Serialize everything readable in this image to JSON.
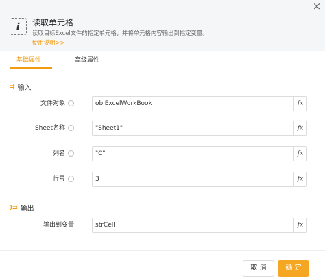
{
  "header": {
    "icon_glyph": "i",
    "title": "读取单元格",
    "description": "读取目标Excel文件的指定单元格，并将单元格内容输出到指定变量。",
    "help_link": "使用说明>>",
    "close_glyph": "×"
  },
  "tabs": [
    {
      "label": "基础属性",
      "active": true
    },
    {
      "label": "高级属性",
      "active": false
    }
  ],
  "input_section": {
    "icon": "⇉",
    "title": "输入",
    "fields": [
      {
        "label": "文件对象",
        "value": "objExcelWorkBook",
        "fx": "fx"
      },
      {
        "label": "Sheet名称",
        "value": "\"Sheet1\"",
        "fx": "fx"
      },
      {
        "label": "列名",
        "value": "\"C\"",
        "fx": "fx"
      },
      {
        "label": "行号",
        "value": "3",
        "fx": "fx"
      }
    ]
  },
  "output_section": {
    "icon": ")⇉",
    "title": "输出",
    "fields": [
      {
        "label": "输出到变量",
        "value": "strCell",
        "fx": "fx"
      }
    ]
  },
  "footer": {
    "cancel_label": "取 消",
    "ok_label": "确 定"
  },
  "info_glyph": "i",
  "colors": {
    "accent": "#f39c12",
    "primary_button": "#f5a623"
  }
}
